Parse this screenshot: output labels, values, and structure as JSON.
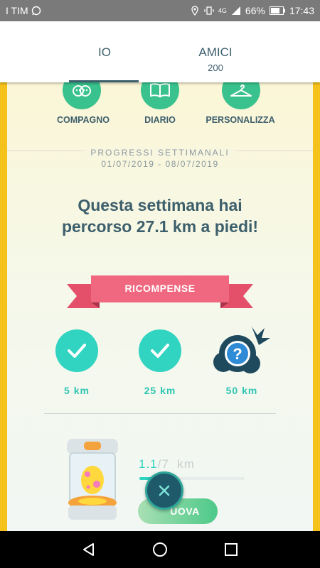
{
  "status_bar": {
    "carrier": "I TIM",
    "battery": "66%",
    "network": "4G",
    "time": "17:43"
  },
  "tabs": [
    {
      "label": "IO",
      "sub": ""
    },
    {
      "label": "AMICI",
      "sub": "200"
    }
  ],
  "menu": [
    {
      "label": "COMPAGNO",
      "icon": "buddy-icon"
    },
    {
      "label": "DIARIO",
      "icon": "journal-icon"
    },
    {
      "label": "PERSONALIZZA",
      "icon": "hanger-icon"
    }
  ],
  "weekly": {
    "title": "PROGRESSI SETTIMANALI",
    "dates": "01/07/2019 - 08/07/2019",
    "headline": "Questa settimana hai percorso 27.1 km a piedi!"
  },
  "rewards": {
    "banner": "RICOMPENSE",
    "items": [
      {
        "label": "5 km",
        "status": "completed"
      },
      {
        "label": "25 km",
        "status": "completed"
      },
      {
        "label": "50 km",
        "status": "locked"
      }
    ]
  },
  "egg": {
    "current": "1.1",
    "total": "/7",
    "unit": "km",
    "progress_fraction": 0.157,
    "button_label": "UOVA"
  },
  "colors": {
    "frame": "#f4c21a",
    "accent_teal": "#31d3c1",
    "menu_green": "#39c28d",
    "ribbon": "#f0687f",
    "text_dark": "#3d5f6c"
  }
}
